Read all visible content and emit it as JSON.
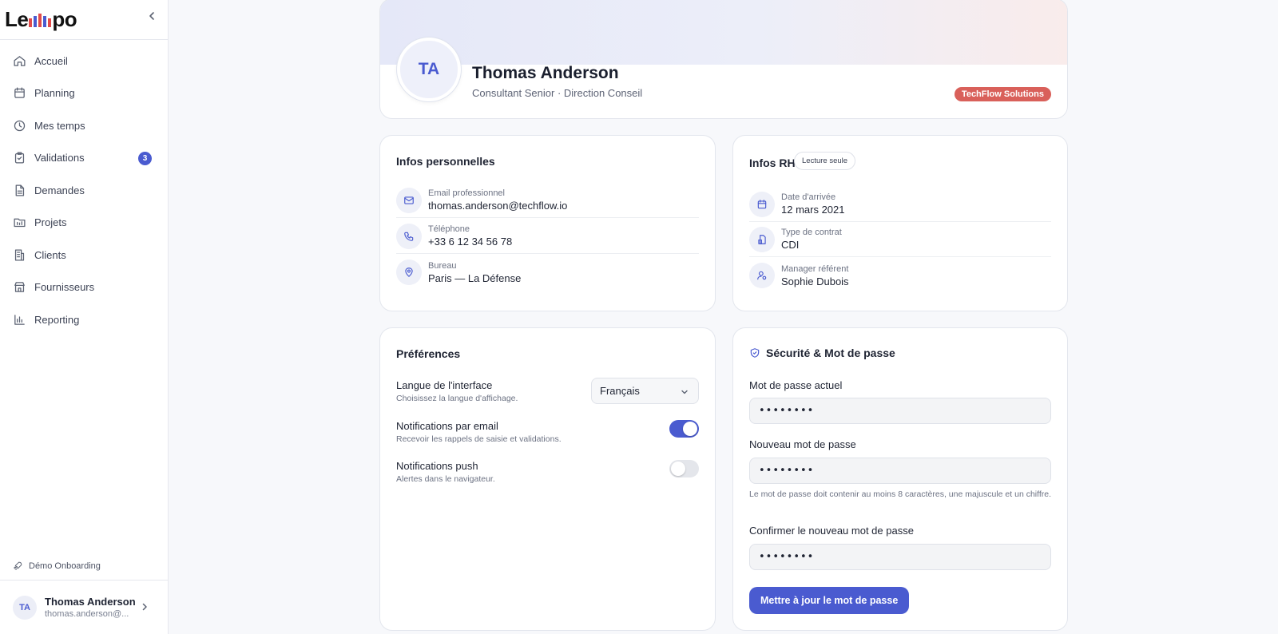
{
  "brand": {
    "logo_start": "Le",
    "logo_end": "po",
    "logo_bar_colors": [
      "#e24a4a",
      "#4a5bd0",
      "#e24a4a",
      "#4a5bd0",
      "#e24a4a"
    ]
  },
  "sidebar": {
    "items": [
      {
        "label": "Accueil",
        "icon": "home-icon"
      },
      {
        "label": "Planning",
        "icon": "calendar-icon"
      },
      {
        "label": "Mes temps",
        "icon": "clock-icon"
      },
      {
        "label": "Validations",
        "icon": "clipboard-check-icon",
        "badge": "3"
      },
      {
        "label": "Demandes",
        "icon": "document-icon"
      },
      {
        "label": "Projets",
        "icon": "folder-icon"
      },
      {
        "label": "Clients",
        "icon": "building-icon"
      },
      {
        "label": "Fournisseurs",
        "icon": "store-icon"
      },
      {
        "label": "Reporting",
        "icon": "bar-chart-icon"
      }
    ],
    "demo_label": "Démo Onboarding",
    "user": {
      "initials": "TA",
      "name": "Thomas Anderson",
      "email": "thomas.anderson@..."
    }
  },
  "profile": {
    "initials": "TA",
    "name": "Thomas Anderson",
    "role": "Consultant Senior · Direction Conseil",
    "company": "TechFlow Solutions"
  },
  "personal": {
    "title": "Infos personnelles",
    "rows": [
      {
        "label": "Email professionnel",
        "value": "thomas.anderson@techflow.io",
        "icon": "mail-icon"
      },
      {
        "label": "Téléphone",
        "value": "+33 6 12 34 56 78",
        "icon": "phone-icon"
      },
      {
        "label": "Bureau",
        "value": "Paris — La Défense",
        "icon": "map-pin-icon"
      }
    ]
  },
  "hr": {
    "title": "Infos RH",
    "readonly": "Lecture seule",
    "rows": [
      {
        "label": "Date d'arrivée",
        "value": "12 mars 2021",
        "icon": "calendar-icon"
      },
      {
        "label": "Type de contrat",
        "value": "CDI",
        "icon": "contract-icon"
      },
      {
        "label": "Manager référent",
        "value": "Sophie Dubois",
        "icon": "user-settings-icon"
      }
    ]
  },
  "preferences": {
    "title": "Préférences",
    "language": {
      "title": "Langue de l'interface",
      "sub": "Choisissez la langue d'affichage.",
      "value": "Français"
    },
    "email_notif": {
      "title": "Notifications par email",
      "sub": "Recevoir les rappels de saisie et validations.",
      "on": true
    },
    "push_notif": {
      "title": "Notifications push",
      "sub": "Alertes dans le navigateur.",
      "on": false
    }
  },
  "security": {
    "title": "Sécurité & Mot de passe",
    "current_label": "Mot de passe actuel",
    "current_value": "••••••••",
    "new_label": "Nouveau mot de passe",
    "new_value": "••••••••",
    "hint": "Le mot de passe doit contenir au moins 8 caractères, une majuscule et un chiffre.",
    "confirm_label": "Confirmer le nouveau mot de passe",
    "confirm_value": "••••••••",
    "submit": "Mettre à jour le mot de passe"
  },
  "colors": {
    "accent": "#4a5bd0",
    "company_chip": "#d9605a"
  }
}
